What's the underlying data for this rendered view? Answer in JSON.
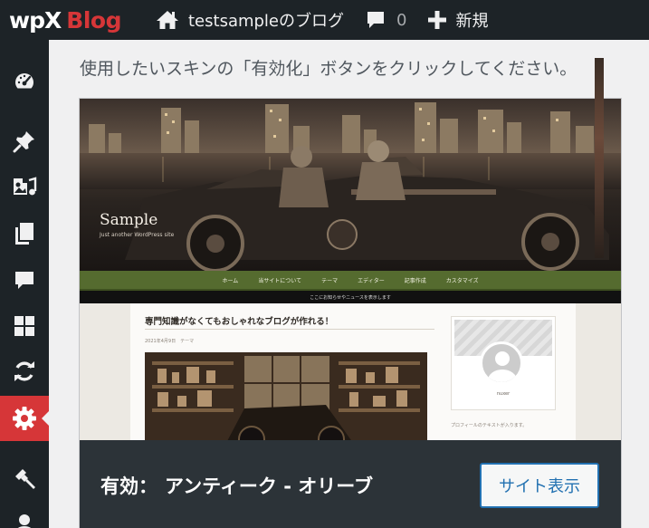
{
  "adminbar": {
    "logo_wpx": "wpX",
    "logo_blog": "Blog",
    "site_name": "testsampleのブログ",
    "comments_count": "0",
    "new_label": "新規"
  },
  "sidebar": {
    "items": [
      {
        "icon": "dashboard-icon"
      },
      {
        "icon": "pin-icon"
      },
      {
        "icon": "media-icon"
      },
      {
        "icon": "pages-icon"
      },
      {
        "icon": "comments-icon"
      },
      {
        "icon": "blocks-icon"
      },
      {
        "icon": "refresh-icon"
      },
      {
        "icon": "gear-icon",
        "active": true
      },
      {
        "icon": "brush-icon"
      },
      {
        "icon": "user-icon"
      }
    ]
  },
  "main": {
    "instruction": "使用したいスキンの「有効化」ボタンをクリックしてください。",
    "theme": {
      "status_prefix": "有効：",
      "name": "アンティーク - オリーブ",
      "view_site_label": "サイト表示",
      "preview": {
        "site_title": "Sample",
        "tagline": "Just another WordPress site",
        "nav": [
          "ホーム",
          "当サイトについて",
          "テーマ",
          "エディター",
          "記事作成",
          "カスタマイズ"
        ],
        "notice": "ここにお知らせやニュースを表示します",
        "post_title": "専門知識がなくてもおしゃれなブログが作れる！",
        "post_meta": "2021年4月9日　テーマ",
        "author": "nuxer",
        "profile_text": "プロフィールのテキストが入ります。"
      }
    }
  },
  "colors": {
    "adminbar": "#1d2327",
    "active_menu": "#d63638",
    "footer": "#2c3338",
    "button_border": "#2271b1",
    "nav_olive": "#556b2f"
  }
}
